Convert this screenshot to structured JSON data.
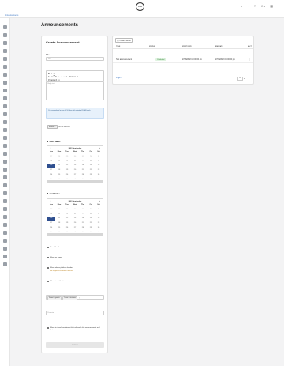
{
  "app": {
    "logo_text": "LOGO",
    "breadcrumb": "Announcements"
  },
  "page": {
    "title": "Announcements"
  },
  "form": {
    "heading": "Create Announcement",
    "title_label": "Title *",
    "title_placeholder": "Title",
    "toolbar": {
      "paragraph": "Paragraph",
      "normal": "Normal",
      "heading": "H",
      "bold": "B",
      "italic": "I",
      "underline": "U",
      "strike": "S",
      "code": "<>",
      "quote": "“",
      "link": "∞",
      "list_ul": "•",
      "list_ol": "1."
    },
    "editor_placeholder": "Body text",
    "info_text": "You can upload a max of 10 files with a limit of 10MB each",
    "file_button": "Browse...",
    "file_status": "No file selected.",
    "start_date_label": "start date:",
    "end_date_label": "end date:",
    "cal_start": {
      "month": "2023 September",
      "days_header": [
        "Sun",
        "Mon",
        "Tue",
        "Wed",
        "Thu",
        "Fri",
        "Sat"
      ],
      "weeks": [
        [
          "27",
          "28",
          "29",
          "30",
          "31",
          "1",
          "2"
        ],
        [
          "3",
          "4",
          "5",
          "6",
          "7",
          "8",
          "9"
        ],
        [
          "10",
          "11",
          "12",
          "13",
          "14",
          "15",
          "16"
        ],
        [
          "17",
          "18",
          "19",
          "20",
          "21",
          "22",
          "23"
        ],
        [
          "24",
          "25",
          "26",
          "27",
          "28",
          "29",
          "30"
        ],
        [
          "1",
          "2",
          "3",
          "4",
          "5",
          "6",
          "7"
        ]
      ]
    },
    "cal_end": {
      "month": "2023 September",
      "days_header": [
        "Sun",
        "Mon",
        "Tue",
        "Wed",
        "Thu",
        "Fri",
        "Sat"
      ],
      "weeks": [
        [
          "27",
          "28",
          "29",
          "30",
          "31",
          "1",
          "2"
        ],
        [
          "3",
          "4",
          "5",
          "6",
          "7",
          "8",
          "9"
        ],
        [
          "10",
          "11",
          "12",
          "13",
          "14",
          "15",
          "16"
        ],
        [
          "17",
          "18",
          "19",
          "20",
          "21",
          "22",
          "23"
        ],
        [
          "24",
          "25",
          "26",
          "27",
          "28",
          "29",
          "30"
        ],
        [
          "1",
          "2",
          "3",
          "4",
          "5",
          "6",
          "7"
        ]
      ]
    },
    "send_email": "Send Email",
    "show_as_popup": "Show as popup",
    "show_above_header": "Show above platform header",
    "not_supported_note": "Not supported on mobile devices",
    "show_in_notifications": "Show in notifications only",
    "tags": [
      "Show to guests",
      "Show to trainees"
    ],
    "tags_clear": "×",
    "domain_placeholder": "Domain",
    "issue_reminder": "Show in issue/ recruitment that will reach the announcement end date",
    "submit": "Submit"
  },
  "table": {
    "create_button": "Create Column",
    "columns": [
      "Title",
      "Status",
      "Start Date",
      "End Date",
      "Act"
    ],
    "rows": [
      {
        "title": "Test announcement",
        "status": "Published",
        "start": "27/09/2023 10:00:00 am",
        "end": "27/09/2023 05:00:00 pm"
      }
    ],
    "pager_link": "Page 1",
    "page_size": "10"
  }
}
